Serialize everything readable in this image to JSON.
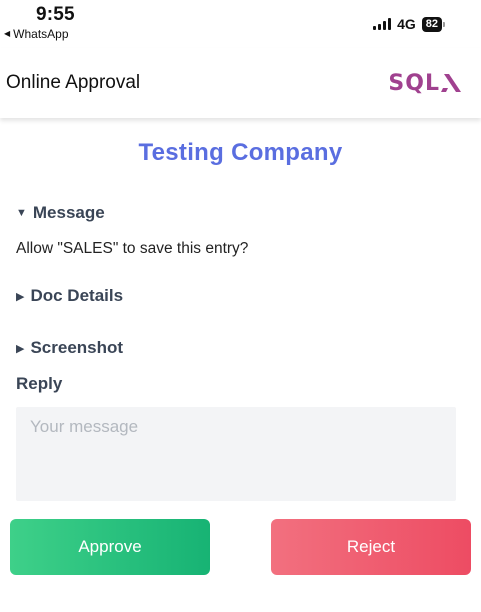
{
  "status_bar": {
    "time": "9:55",
    "back_app": "WhatsApp",
    "network": "4G",
    "battery": "82"
  },
  "header": {
    "title": "Online Approval",
    "logo_text": "SQL",
    "logo_color": "#a0418f"
  },
  "company": {
    "name": "Testing Company",
    "color": "#5a6ee0"
  },
  "sections": {
    "message": {
      "label": "Message",
      "expanded": true,
      "text": "Allow \"SALES\" to save this entry?"
    },
    "doc_details": {
      "label": "Doc Details",
      "expanded": false
    },
    "screenshot": {
      "label": "Screenshot",
      "expanded": false
    }
  },
  "reply": {
    "label": "Reply",
    "placeholder": "Your message",
    "value": ""
  },
  "actions": {
    "approve_label": "Approve",
    "reject_label": "Reject",
    "approve_color": "#17b374",
    "reject_color": "#ed4c63"
  },
  "icons": {
    "back": "back-triangle-icon",
    "signal": "signal-bars-icon",
    "battery": "battery-icon",
    "expanded": "triangle-down-icon",
    "collapsed": "triangle-right-icon"
  }
}
